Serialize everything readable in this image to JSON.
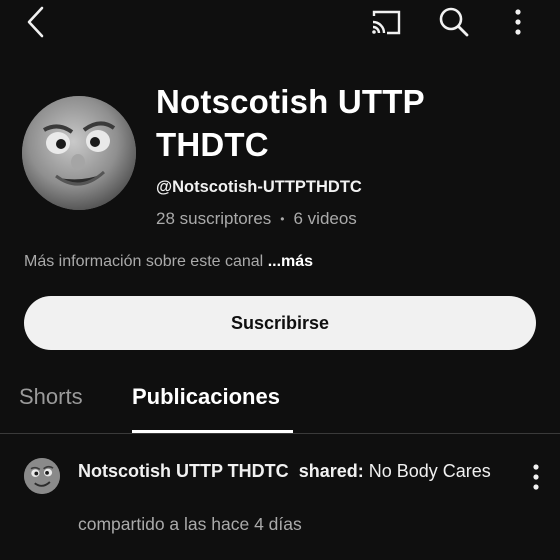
{
  "topbar": {
    "back_icon": "chevron-left-icon",
    "cast_icon": "cast-icon",
    "search_icon": "search-icon",
    "more_icon": "more-vertical-icon"
  },
  "channel": {
    "name": "Notscotish UTTP THDTC",
    "handle": "@Notscotish-UTTPTHDTC",
    "subscribers": "28 suscriptores",
    "separator": "•",
    "videos": "6 videos",
    "more_info": "Más información sobre este canal",
    "more_link": "...más",
    "subscribe_label": "Suscribirse"
  },
  "tabs": [
    {
      "label": "Shorts",
      "active": false
    },
    {
      "label": "Publicaciones",
      "active": true
    }
  ],
  "post": {
    "author": "Notscotish UTTP THDTC",
    "shared_label": "shared:",
    "shared_title": "No Body Cares",
    "timestamp": "compartido a las hace 4 días",
    "menu_icon": "more-vertical-icon"
  },
  "colors": {
    "background": "#0f0f0f",
    "text_primary": "#f1f1f1",
    "text_secondary": "#aaaaaa",
    "button_bg": "#f1f1f1"
  }
}
